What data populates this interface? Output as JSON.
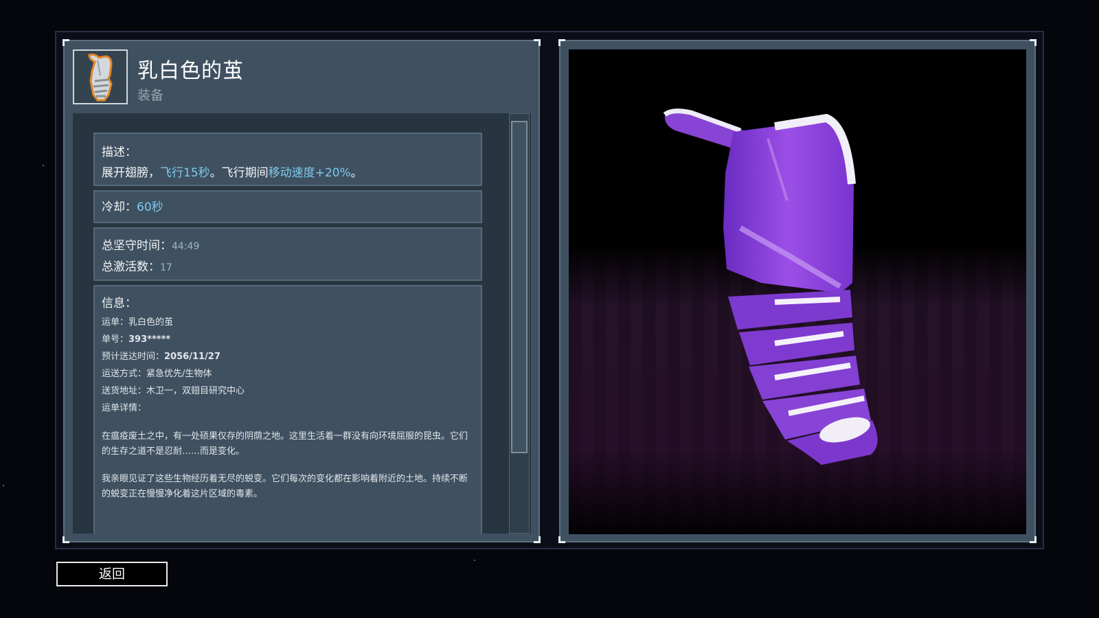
{
  "item": {
    "title": "乳白色的茧",
    "type": "装备",
    "icon": "cocoon-icon"
  },
  "description": {
    "label": "描述：",
    "text_a": "展开翅膀，",
    "text_b": "飞行15秒",
    "text_c": "。飞行期间",
    "text_d": "移动速度+20%",
    "text_e": "。"
  },
  "cooldown": {
    "label": "冷却：",
    "value": "60秒"
  },
  "stats": {
    "hold_time_label": "总坚守时间：",
    "hold_time_value": "44:49",
    "activations_label": "总激活数：",
    "activations_value": "17"
  },
  "info": {
    "label": "信息：",
    "waybill_label": "运单：",
    "waybill_value": "乳白色的茧",
    "number_label": "单号：",
    "number_value": "393*****",
    "eta_label": "预计送达时间：",
    "eta_value": "2056/11/27",
    "method_label": "运送方式：",
    "method_value": "紧急优先/生物体",
    "address_label": "送货地址：",
    "address_value": "木卫一，双翅目研究中心",
    "details_label": "运单详情：",
    "paragraph_1": "在瘟疫废土之中，有一处硕果仅存的阴荫之地。这里生活着一群没有向环境屈服的昆虫。它们的生存之道不是忍耐……而是变化。",
    "paragraph_2": "我亲眼见证了这些生物经历着无尽的蜕变。它们每次的变化都在影响着附近的土地。持续不断的蜕变正在慢慢净化着这片区域的毒素。"
  },
  "buttons": {
    "back_label": "返回"
  },
  "colors": {
    "accent": "#7ec9ec",
    "panel": "#3f5161",
    "cocoon_purple": "#8a3fd8"
  },
  "scroll": {
    "thumb_fraction": 0.82
  }
}
